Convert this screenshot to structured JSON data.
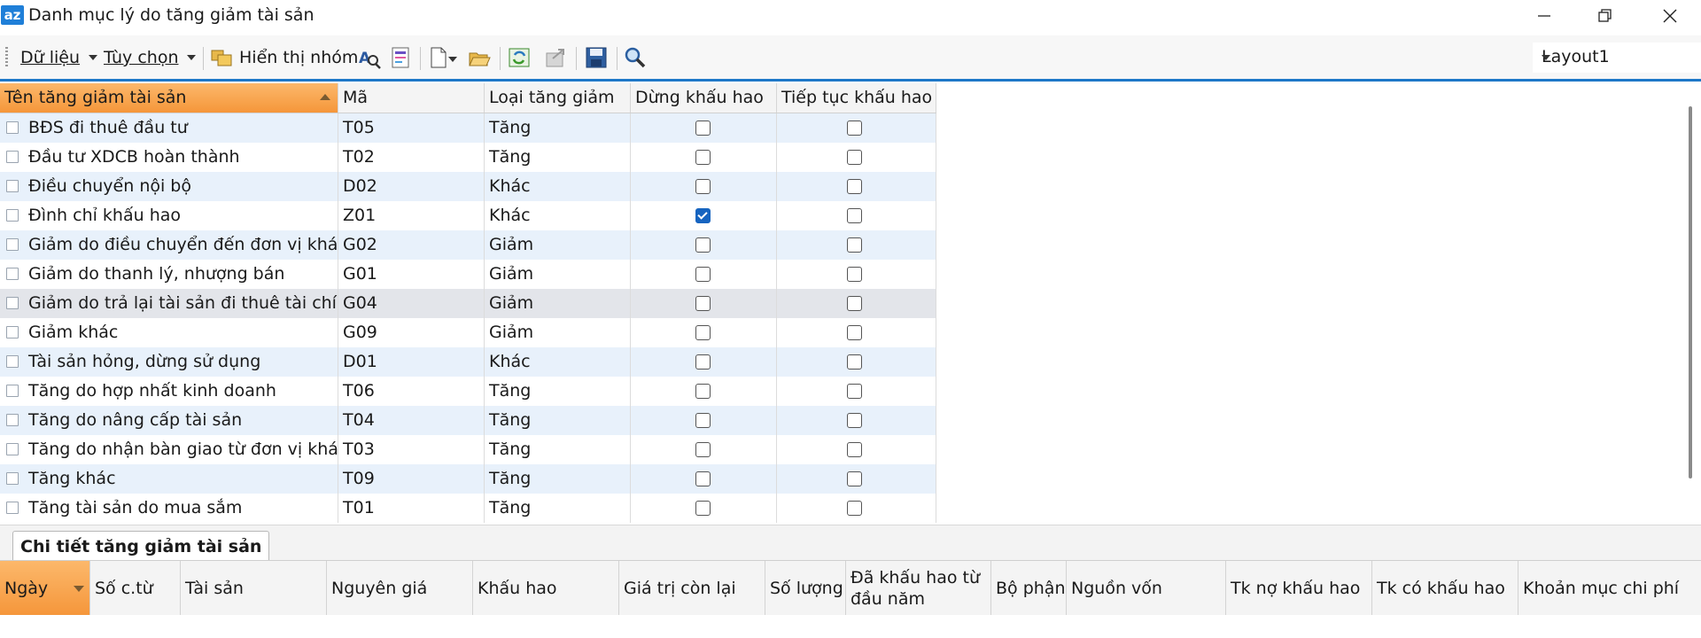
{
  "window": {
    "title": "Danh mục lý do tăng giảm tài sản",
    "app_icon_text": "az"
  },
  "toolbar": {
    "data_menu": "Dữ liệu",
    "options_menu": "Tùy chọn",
    "group_view": "Hiển thị nhóm",
    "layout": "Layout1"
  },
  "grid": {
    "columns": [
      "Tên tăng giảm tài sản",
      "Mã",
      "Loại tăng giảm",
      "Dừng khấu hao",
      "Tiếp tục khấu hao"
    ],
    "rows": [
      {
        "name": "BĐS đi thuê đầu tư",
        "code": "T05",
        "type": "Tăng",
        "stop": false,
        "resume": false
      },
      {
        "name": "Đầu tư XDCB hoàn thành",
        "code": "T02",
        "type": "Tăng",
        "stop": false,
        "resume": false
      },
      {
        "name": "Điều chuyển nội bộ",
        "code": "D02",
        "type": "Khác",
        "stop": false,
        "resume": false
      },
      {
        "name": "Đình chỉ khấu hao",
        "code": "Z01",
        "type": "Khác",
        "stop": true,
        "resume": false
      },
      {
        "name": "Giảm do điều chuyển đến đơn vị khác",
        "code": "G02",
        "type": "Giảm",
        "stop": false,
        "resume": false
      },
      {
        "name": "Giảm do thanh lý, nhượng bán",
        "code": "G01",
        "type": "Giảm",
        "stop": false,
        "resume": false
      },
      {
        "name": "Giảm do trả lại tài sản đi thuê tài chính",
        "code": "G04",
        "type": "Giảm",
        "stop": false,
        "resume": false
      },
      {
        "name": "Giảm khác",
        "code": "G09",
        "type": "Giảm",
        "stop": false,
        "resume": false
      },
      {
        "name": "Tài sản hỏng, dừng sử dụng",
        "code": "D01",
        "type": "Khác",
        "stop": false,
        "resume": false
      },
      {
        "name": "Tăng do hợp nhất kinh doanh",
        "code": "T06",
        "type": "Tăng",
        "stop": false,
        "resume": false
      },
      {
        "name": "Tăng do nâng cấp tài sản",
        "code": "T04",
        "type": "Tăng",
        "stop": false,
        "resume": false
      },
      {
        "name": "Tăng do nhận bàn giao từ đơn vị khác",
        "code": "T03",
        "type": "Tăng",
        "stop": false,
        "resume": false
      },
      {
        "name": "Tăng khác",
        "code": "T09",
        "type": "Tăng",
        "stop": false,
        "resume": false
      },
      {
        "name": "Tăng tài sản do mua sắm",
        "code": "T01",
        "type": "Tăng",
        "stop": false,
        "resume": false
      }
    ]
  },
  "detail": {
    "tab_label": "Chi tiết tăng giảm tài sản",
    "columns": [
      "Ngày",
      "Số c.từ",
      "Tài sản",
      "Nguyên giá",
      "Khấu hao",
      "Giá trị còn lại",
      "Số lượng",
      "Đã khấu hao từ đầu năm",
      "Bộ phận",
      "Nguồn vốn",
      "Tk nợ khấu hao",
      "Tk có khấu hao",
      "Khoản mục chi phí"
    ]
  }
}
